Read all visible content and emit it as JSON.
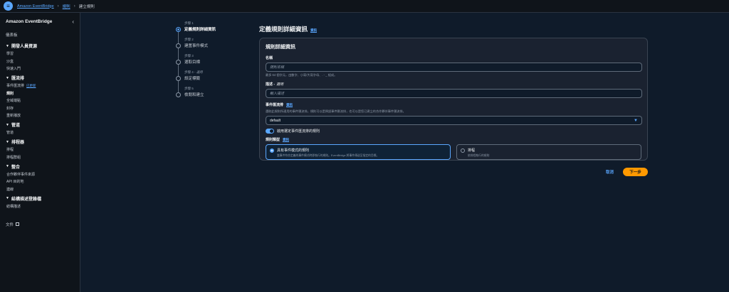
{
  "topbar": {
    "menu_icon": "menu-icon",
    "breadcrumbs": [
      "Amazon EventBridge",
      "規則",
      "建立規則"
    ],
    "accent": "#5aa7ff"
  },
  "sidebar": {
    "title": "Amazon EventBridge",
    "dashboard": "儀表板",
    "sections": [
      {
        "title": "開發人員資源",
        "items": [
          "學習",
          "沙盒",
          "快速入門"
        ]
      },
      {
        "title": "匯流排",
        "items": [
          "事件匯流排",
          "規則",
          "全域端點",
          "封存",
          "重新播放"
        ],
        "badge": "已更新"
      },
      {
        "title": "管道",
        "items": [
          "管道"
        ]
      },
      {
        "title": "排程器",
        "items": [
          "排程",
          "排程群組"
        ]
      },
      {
        "title": "整合",
        "items": [
          "合作夥伴事件來源",
          "API 目的地",
          "連線"
        ]
      },
      {
        "title": "結構描述登錄檔",
        "items": [
          "結構描述"
        ]
      }
    ],
    "doc_link": "文件"
  },
  "steps": [
    {
      "num": "步驟 1",
      "label": "定義規則詳細資訊",
      "optional": ""
    },
    {
      "num": "步驟 2",
      "label": "建置事件模式",
      "optional": ""
    },
    {
      "num": "步驟 3",
      "label": "選取目標",
      "optional": ""
    },
    {
      "num": "步驟 4 - ",
      "label": "設定標籤",
      "optional": "選用"
    },
    {
      "num": "步驟 5",
      "label": "檢閱和建立",
      "optional": ""
    }
  ],
  "main": {
    "title": "定義規則詳細資訊",
    "info": "資訊",
    "panel_title": "規則詳細資訊",
    "name_label": "名稱",
    "name_placeholder": "規則名稱",
    "name_hint": "最多 64 個字元，由數字、小寫/大寫字母、. - _ 組成。",
    "desc_label": "描述 - ",
    "desc_optional": "選用",
    "desc_placeholder": "輸入描述",
    "bus_label": "事件匯流排",
    "bus_info": "資訊",
    "bus_hint": "選取此規則所適用的事件匯流排。規則可以是預設事件匯流排，也可以是您已建立的合作夥伴事件匯流排。",
    "bus_value": "default",
    "toggle_label": "啟用選定事件匯流排的規則",
    "rule_type_label": "規則類型",
    "rule_type_info": "資訊",
    "rule_types": [
      {
        "name": "具有事件模式的規則",
        "desc": "當事件符合定義的事件模式時即執行的規則。EventBridge 將事件傳送至指定的目標。"
      },
      {
        "name": "排程",
        "desc": "依排程執行的規則"
      }
    ],
    "cancel": "取消",
    "next": "下一步"
  }
}
